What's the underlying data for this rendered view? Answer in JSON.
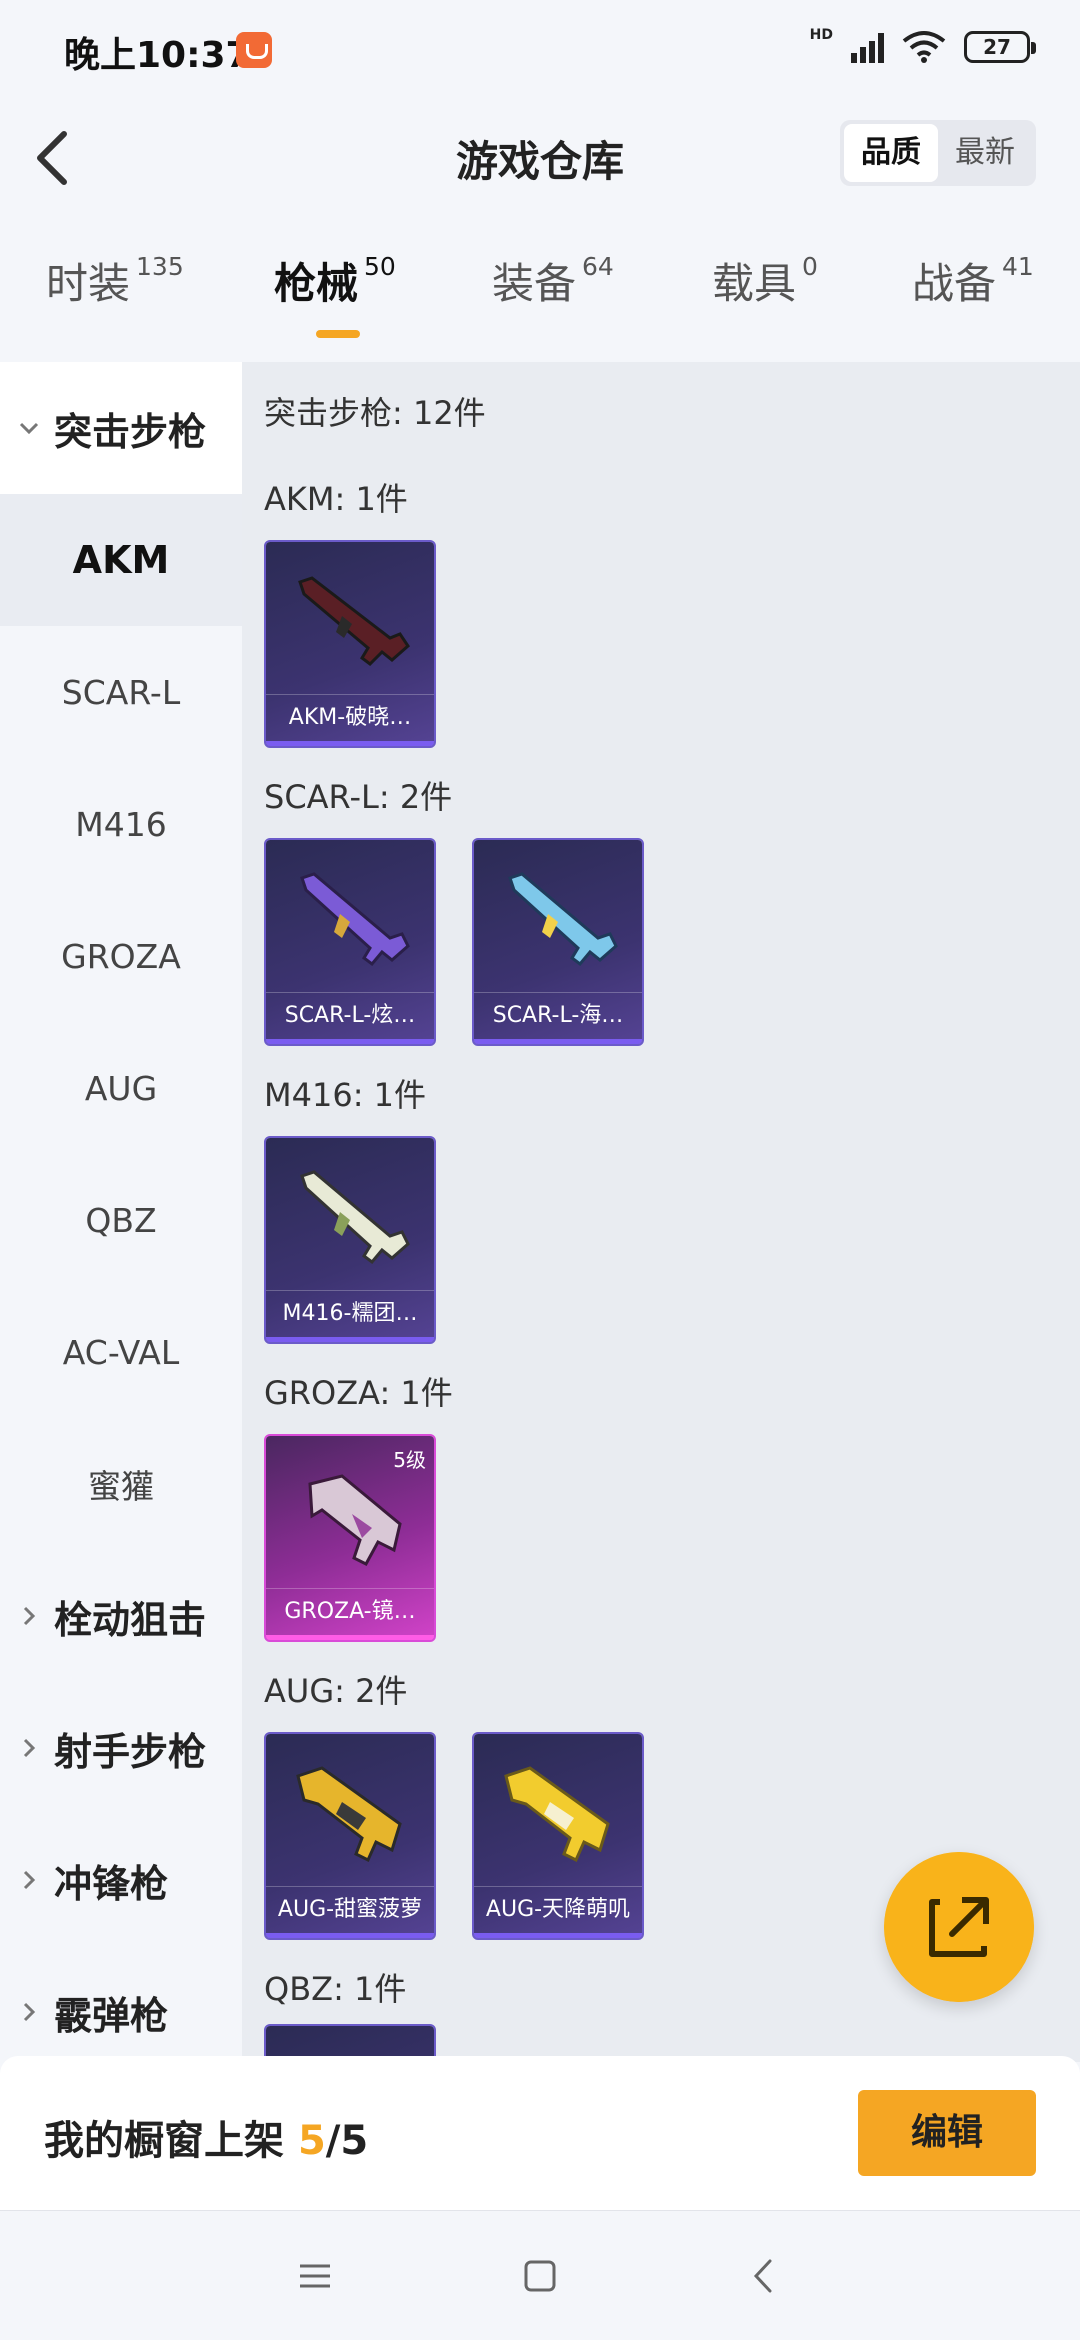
{
  "status_bar": {
    "time": "晚上10:37",
    "network": "HD",
    "battery": "27"
  },
  "header": {
    "title": "游戏仓库",
    "sort_options": [
      {
        "label": "品质",
        "active": true
      },
      {
        "label": "最新",
        "active": false
      }
    ]
  },
  "tabs": [
    {
      "label": "时装",
      "count": "135"
    },
    {
      "label": "枪械",
      "count": "50",
      "active": true
    },
    {
      "label": "装备",
      "count": "64"
    },
    {
      "label": "载具",
      "count": "0"
    },
    {
      "label": "战备",
      "count": "41"
    }
  ],
  "sidebar": {
    "groups": [
      {
        "label": "突击步枪",
        "expanded": true
      },
      {
        "label": "栓动狙击"
      },
      {
        "label": "射手步枪"
      },
      {
        "label": "冲锋枪"
      },
      {
        "label": "霰弹枪"
      }
    ],
    "items": [
      "AKM",
      "SCAR-L",
      "M416",
      "GROZA",
      "AUG",
      "QBZ",
      "AC-VAL",
      "蜜獾"
    ],
    "selected": "AKM"
  },
  "main": {
    "summary": "突击步枪: 12件",
    "sections": [
      {
        "title": "AKM: 1件",
        "cards": [
          {
            "name": "AKM-破晓…",
            "rarity": "purple"
          }
        ]
      },
      {
        "title": "SCAR-L: 2件",
        "cards": [
          {
            "name": "SCAR-L-炫…",
            "rarity": "purple"
          },
          {
            "name": "SCAR-L-海…",
            "rarity": "purple"
          }
        ]
      },
      {
        "title": "M416: 1件",
        "cards": [
          {
            "name": "M416-糯团…",
            "rarity": "purple"
          }
        ]
      },
      {
        "title": "GROZA: 1件",
        "cards": [
          {
            "name": "GROZA-镜…",
            "rarity": "pink",
            "level": "5级"
          }
        ]
      },
      {
        "title": "AUG: 2件",
        "cards": [
          {
            "name": "AUG-甜蜜菠萝",
            "rarity": "purple"
          },
          {
            "name": "AUG-天降萌叽",
            "rarity": "purple"
          }
        ]
      },
      {
        "title": "QBZ: 1件",
        "cards": []
      }
    ]
  },
  "bottom_bar": {
    "label": "我的橱窗上架",
    "current": "5",
    "separator": "/",
    "total": "5",
    "edit_label": "编辑"
  },
  "icons": {
    "fab": "share-external-icon",
    "nav": [
      "menu-icon",
      "home-square-icon",
      "back-icon"
    ]
  },
  "colors": {
    "accent": "#f5a623",
    "purple_rarity": "#6b5bc9",
    "pink_rarity": "#d94bd8"
  }
}
